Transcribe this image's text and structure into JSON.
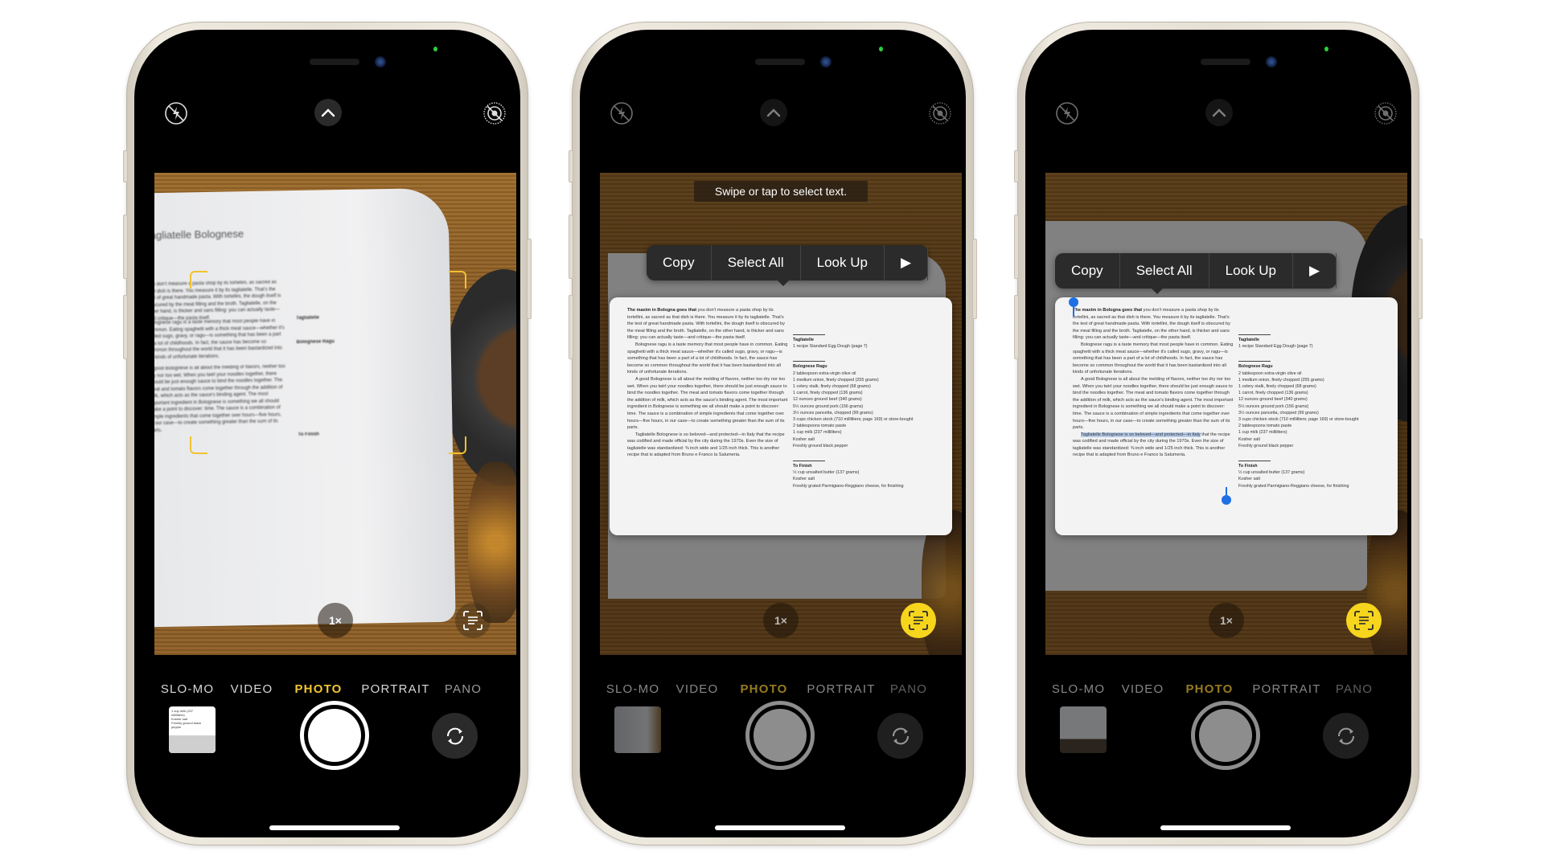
{
  "colors": {
    "frame": "#e6e0d4",
    "accent_yellow": "#f3c533",
    "live_text_active": "#f7d51d",
    "selection_blue": "#1f6fe5",
    "menu_bg": "#2b2b2b"
  },
  "camera_icons": {
    "flash": "flash-off-icon",
    "chevron": "chevron-up-icon",
    "live_photo": "live-photo-off-icon",
    "live_text": "live-text-icon",
    "flip": "camera-flip-icon"
  },
  "phones": [
    {
      "state": "scanning",
      "zoom_label": "1×",
      "modes": [
        "SLO-MO",
        "VIDEO",
        "PHOTO",
        "PORTRAIT",
        "PANO"
      ],
      "active_mode": "PHOTO",
      "recipe_title": "Tagliatelle Bolognese",
      "thumbnail_lines": [
        "1 cup milk (237",
        "milliliters)",
        "Kosher salt",
        "Freshly ground black",
        "pepper"
      ]
    },
    {
      "state": "live-text-detected",
      "zoom_label": "1×",
      "modes": [
        "SLO-MO",
        "VIDEO",
        "PHOTO",
        "PORTRAIT",
        "PANO"
      ],
      "active_mode": "PHOTO",
      "tooltip": "Swipe or tap to select text.",
      "menu": [
        "Copy",
        "Select All",
        "Look Up",
        "▶"
      ]
    },
    {
      "state": "text-selected",
      "zoom_label": "1×",
      "modes": [
        "SLO-MO",
        "VIDEO",
        "PHOTO",
        "PORTRAIT",
        "PANO"
      ],
      "active_mode": "PHOTO",
      "menu": [
        "Copy",
        "Select All",
        "Look Up",
        "▶"
      ]
    }
  ],
  "recipe": {
    "lead": "The maxim in Bologna goes that",
    "paragraphs": [
      "you don't measure a pasta shop by its tortellini, as sacred as that dish is there. You measure it by its tagliatelle. That's the test of great handmade pasta. With tortellini, the dough itself is obscured by the meat filling and the broth. Tagliatelle, on the other hand, is thicker and sans filling: you can actually taste—and critique—the pasta itself.",
      "Bolognese ragu is a taste memory that most people have in common. Eating spaghetti with a thick meat sauce—whether it's called sugo, gravy, or ragu—is something that has been a part of a lot of childhoods. In fact, the sauce has become so common throughout the world that it has been bastardized into all kinds of unfortunate iterations.",
      "A good Bolognese is all about the melding of flavors, neither too dry nor too wet. When you twirl your noodles together, there should be just enough sauce to bind the noodles together. The meat and tomato flavors come together through the addition of milk, which acts as the sauce's binding agent. The most important ingredient in Bolognese is something we all should make a point to discover: time. The sauce is a combination of simple ingredients that come together over hours—five hours, in our case—to create something greater than the sum of its parts.",
      "Tagliatelle Bolognese is so beloved—and protected—in Italy",
      "that the recipe was codified and made official by the city during the 1970s. Even the size of tagliatelle was standardized: ⅜ inch wide and 1/25 inch thick. This is another recipe that is adapted from Bruno e Franco la Salumeria."
    ],
    "sections": [
      {
        "title": "Tagliatelle",
        "items": [
          "1 recipe Standard Egg Dough (page 7)"
        ]
      },
      {
        "title": "Bolognese Ragu",
        "items": [
          "2 tablespoon extra-virgin olive oil",
          "1 medium onion, finely chopped (255 grams)",
          "1 celery stalk, finely chopped (68 grams)",
          "1 carrot, finely chopped (136 grams)",
          "12 ounces ground beef (340 grams)",
          "5½ ounces ground pork (156 grams)",
          "3½ ounces pancetta, chopped (99 grams)",
          "3 cups chicken stock (710 milliliters; page 169) or store-bought",
          "2 tablespoons tomato paste",
          "1 cup milk (237 milliliters)",
          "Kosher salt",
          "Freshly ground black pepper"
        ]
      },
      {
        "title": "To Finish",
        "items": [
          "½ cup unsalted butter (137 grams)",
          "Kosher salt",
          "Freshly grated Parmigiano-Reggiano cheese, for finishing"
        ]
      }
    ]
  }
}
